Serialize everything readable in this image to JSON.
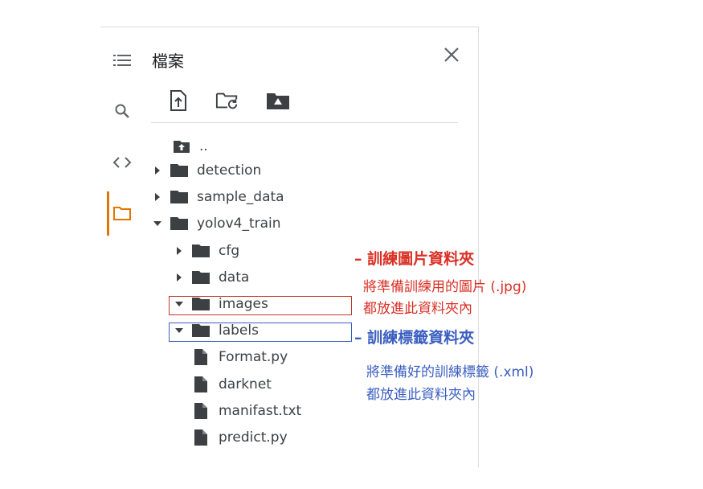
{
  "sidebar": {
    "icons": [
      {
        "name": "menu-icon",
        "active": false
      },
      {
        "name": "search-icon",
        "active": false
      },
      {
        "name": "code-icon",
        "active": false
      },
      {
        "name": "folder-icon",
        "active": true
      }
    ],
    "active_color": "#e37400"
  },
  "panel": {
    "title": "檔案",
    "toolbar": [
      "upload-file-icon",
      "refresh-folder-icon",
      "mount-drive-icon"
    ]
  },
  "tree": {
    "parent": "..",
    "items": [
      {
        "label": "detection",
        "type": "folder",
        "expanded": false,
        "depth": 0
      },
      {
        "label": "sample_data",
        "type": "folder",
        "expanded": false,
        "depth": 0
      },
      {
        "label": "yolov4_train",
        "type": "folder",
        "expanded": true,
        "depth": 0
      },
      {
        "label": "cfg",
        "type": "folder",
        "expanded": false,
        "depth": 1
      },
      {
        "label": "data",
        "type": "folder",
        "expanded": false,
        "depth": 1
      },
      {
        "label": "images",
        "type": "folder",
        "expanded": true,
        "depth": 1
      },
      {
        "label": "labels",
        "type": "folder",
        "expanded": true,
        "depth": 1
      },
      {
        "label": "Format.py",
        "type": "file",
        "depth": 1
      },
      {
        "label": "darknet",
        "type": "file",
        "depth": 1
      },
      {
        "label": "manifast.txt",
        "type": "file",
        "depth": 1
      },
      {
        "label": "predict.py",
        "type": "file",
        "depth": 1
      }
    ]
  },
  "annotations": {
    "images": {
      "heading": "– 訓練圖片資料夾",
      "line1": "將準備訓練用的圖片 (.jpg)",
      "line2": "都放進此資料夾內",
      "color": "#d93025"
    },
    "labels": {
      "heading": "– 訓練標籤資料夾",
      "line1": "將準備好的訓練標籤 (.xml)",
      "line2": "都放進此資料夾內",
      "color": "#3b5fc0"
    }
  }
}
